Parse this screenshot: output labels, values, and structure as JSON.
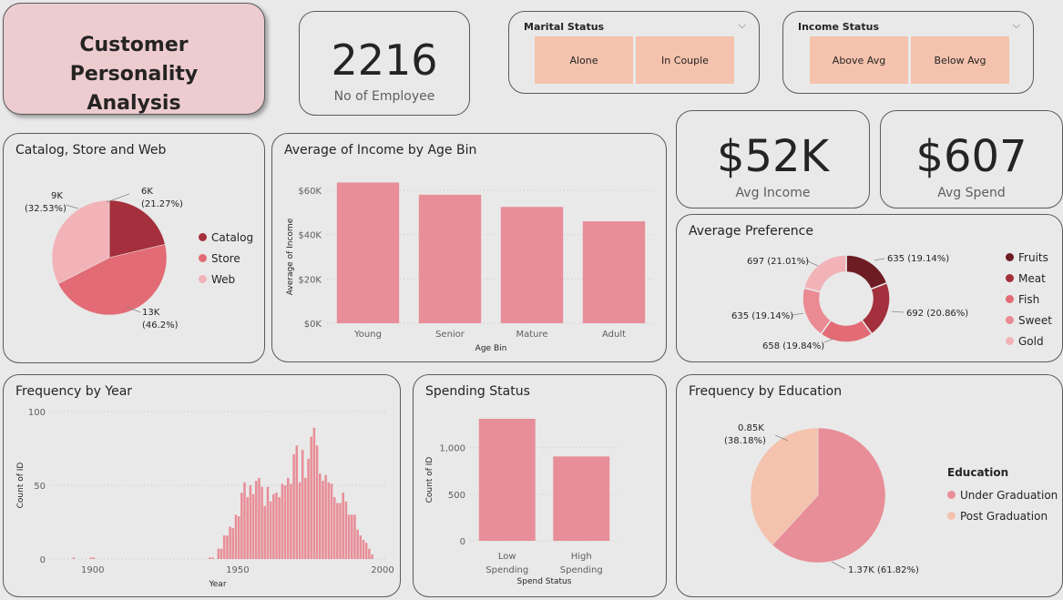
{
  "title": "Customer Personality Analysis",
  "kpis": {
    "employees": {
      "value": "2216",
      "label": "No of Employee"
    },
    "income": {
      "value": "$52K",
      "label": "Avg Income"
    },
    "spend": {
      "value": "$607",
      "label": "Avg  Spend"
    }
  },
  "slicers": {
    "marital": {
      "title": "Marital Status",
      "options": [
        "Alone",
        "In Couple"
      ]
    },
    "income": {
      "title": "Income Status",
      "options": [
        "Above Avg",
        "Below Avg"
      ]
    }
  },
  "colors": {
    "catalog": "#a3303c",
    "store": "#e26b75",
    "web": "#f2b3b8",
    "fruits": "#6e1c24",
    "meat": "#a3303c",
    "fish": "#e26b75",
    "sweet": "#ea8a93",
    "gold": "#f2b3b8",
    "bar": "#e88e98",
    "under_grad": "#e88e98",
    "post_grad": "#f4c2ad"
  },
  "chart_data": [
    {
      "type": "pie",
      "title": "Catalog, Store and Web",
      "slices": [
        {
          "name": "Catalog",
          "value": 6,
          "label_value": "6K",
          "label_pct": "(21.27%)",
          "pct": 21.27
        },
        {
          "name": "Store",
          "value": 13,
          "label_value": "13K",
          "label_pct": "(46.2%)",
          "pct": 46.2
        },
        {
          "name": "Web",
          "value": 9,
          "label_value": "9K",
          "label_pct": "(32.53%)",
          "pct": 32.53
        }
      ]
    },
    {
      "type": "bar",
      "title": "Average of Income by Age Bin",
      "categories": [
        "Young",
        "Senior",
        "Mature",
        "Adult"
      ],
      "values": [
        63500,
        58000,
        52500,
        46000
      ],
      "xlabel": "Age Bin",
      "ylabel": "Average of Income",
      "ylim": [
        0,
        60000
      ],
      "yticks": [
        "$0K",
        "$20K",
        "$40K",
        "$60K"
      ]
    },
    {
      "type": "pie",
      "subtype": "donut",
      "title": "Average Preference",
      "slices": [
        {
          "name": "Fruits",
          "value": 635,
          "pct": 19.14,
          "label": "635 (19.14%)"
        },
        {
          "name": "Meat",
          "value": 692,
          "pct": 20.86,
          "label": "692 (20.86%)"
        },
        {
          "name": "Fish",
          "value": 658,
          "pct": 19.84,
          "label": "658 (19.84%)"
        },
        {
          "name": "Sweet",
          "value": 635,
          "pct": 19.14,
          "label": "635 (19.14%)"
        },
        {
          "name": "Gold",
          "value": 697,
          "pct": 21.01,
          "label": "697 (21.01%)"
        }
      ]
    },
    {
      "type": "bar",
      "title": "Frequency by Year",
      "xlabel": "Year",
      "ylabel": "Count of ID",
      "xticks": [
        "1900",
        "1950",
        "2000"
      ],
      "yticks": [
        "0",
        "50",
        "100"
      ],
      "ylim": [
        0,
        100
      ],
      "xlim": [
        1885,
        2000
      ],
      "x": [
        1893,
        1899,
        1900,
        1940,
        1941,
        1943,
        1944,
        1945,
        1946,
        1947,
        1948,
        1949,
        1950,
        1951,
        1952,
        1953,
        1954,
        1955,
        1956,
        1957,
        1958,
        1959,
        1960,
        1961,
        1962,
        1963,
        1964,
        1965,
        1966,
        1967,
        1968,
        1969,
        1970,
        1971,
        1972,
        1973,
        1974,
        1975,
        1976,
        1977,
        1978,
        1979,
        1980,
        1981,
        1982,
        1983,
        1984,
        1985,
        1986,
        1987,
        1988,
        1989,
        1990,
        1991,
        1992,
        1993,
        1994,
        1995,
        1996
      ],
      "values": [
        1,
        1,
        1,
        1,
        1,
        7,
        7,
        16,
        16,
        22,
        21,
        30,
        29,
        45,
        52,
        42,
        50,
        44,
        53,
        55,
        49,
        36,
        49,
        39,
        44,
        45,
        42,
        51,
        50,
        55,
        51,
        71,
        77,
        52,
        74,
        55,
        68,
        83,
        89,
        77,
        58,
        53,
        57,
        52,
        51,
        42,
        38,
        38,
        45,
        39,
        30,
        30,
        30,
        20,
        16,
        13,
        11,
        7,
        3
      ]
    },
    {
      "type": "bar",
      "title": "Spending Status",
      "categories": [
        "Low Spending",
        "High Spending"
      ],
      "values": [
        1310,
        906
      ],
      "xlabel": "Spend Status",
      "ylabel": "Count of ID",
      "ylim": [
        0,
        1310
      ],
      "yticks": [
        "0",
        "500",
        "1,000"
      ]
    },
    {
      "type": "pie",
      "title": "Frequency by Education",
      "legend_title": "Education",
      "slices": [
        {
          "name": "Under Graduation",
          "value": 1.37,
          "pct": 61.82,
          "label": "1.37K (61.82%)"
        },
        {
          "name": "Post Graduation",
          "value": 0.85,
          "pct": 38.18,
          "label_value": "0.85K",
          "label_pct": "(38.18%)"
        }
      ]
    }
  ]
}
